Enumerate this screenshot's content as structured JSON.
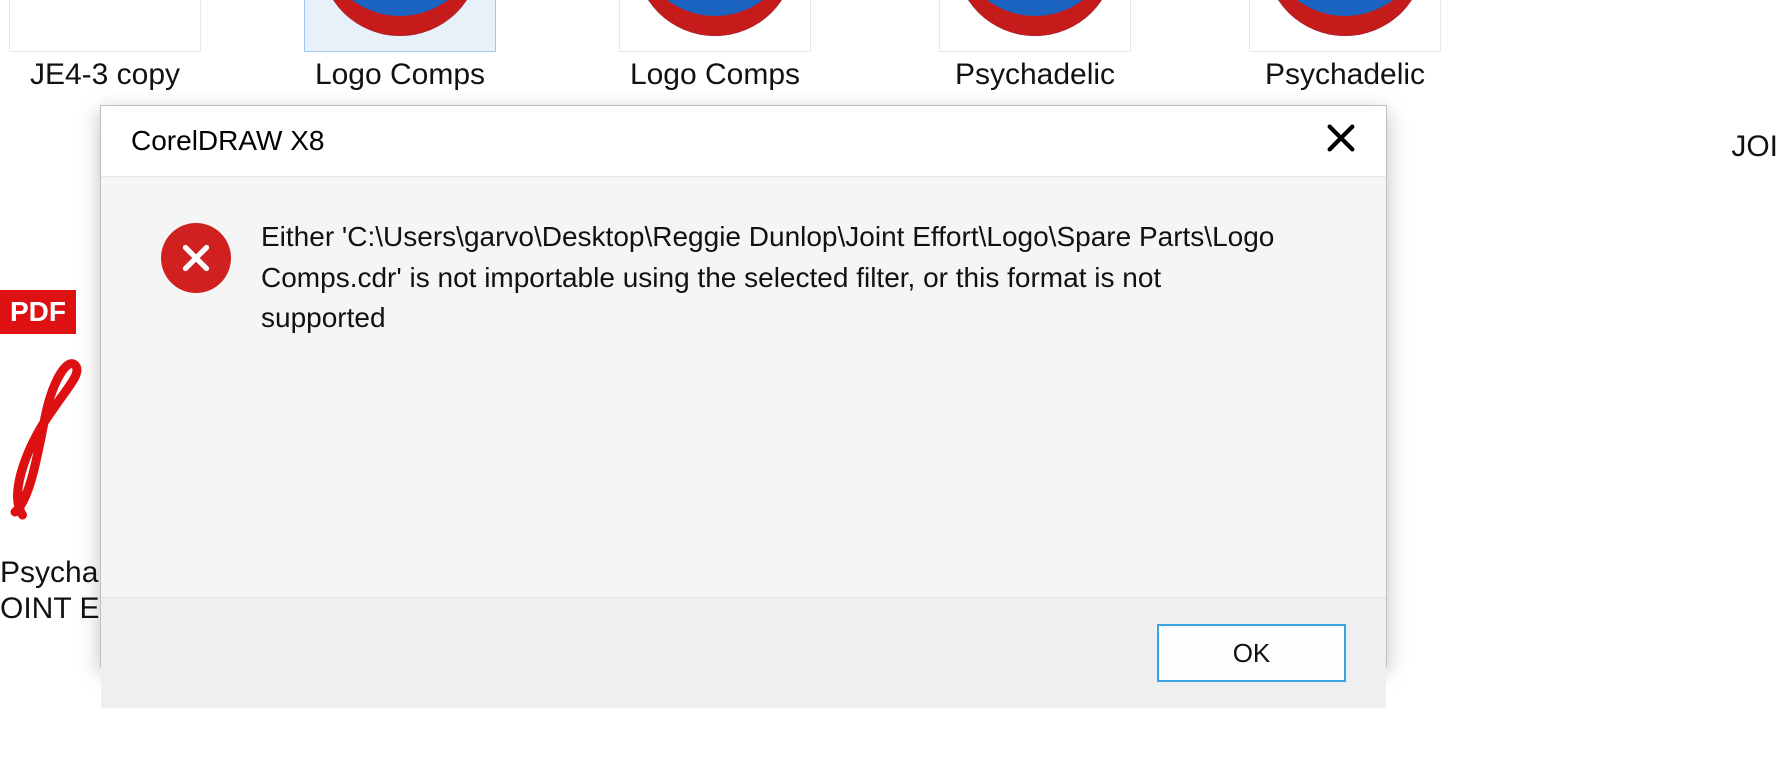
{
  "background": {
    "thumbs": [
      {
        "label": "JE4-3 copy",
        "kind": "blank"
      },
      {
        "label": "Logo Comps",
        "kind": "logo",
        "selected": true
      },
      {
        "label": "Logo Comps",
        "kind": "logo"
      },
      {
        "label": "Psychadelic",
        "kind": "logo"
      },
      {
        "label": "Psychadelic",
        "kind": "logo"
      }
    ],
    "pdf_tag": "PDF",
    "pdf_label_line1": "Psycha",
    "pdf_label_line2": "OINT EI",
    "right_cut_label": "JOI"
  },
  "dialog": {
    "title": "CorelDRAW X8",
    "message": "Either 'C:\\Users\\garvo\\Desktop\\Reggie Dunlop\\Joint Effort\\Logo\\Spare Parts\\Logo Comps.cdr' is not importable using the selected filter, or this format is not supported",
    "ok_label": "OK"
  }
}
